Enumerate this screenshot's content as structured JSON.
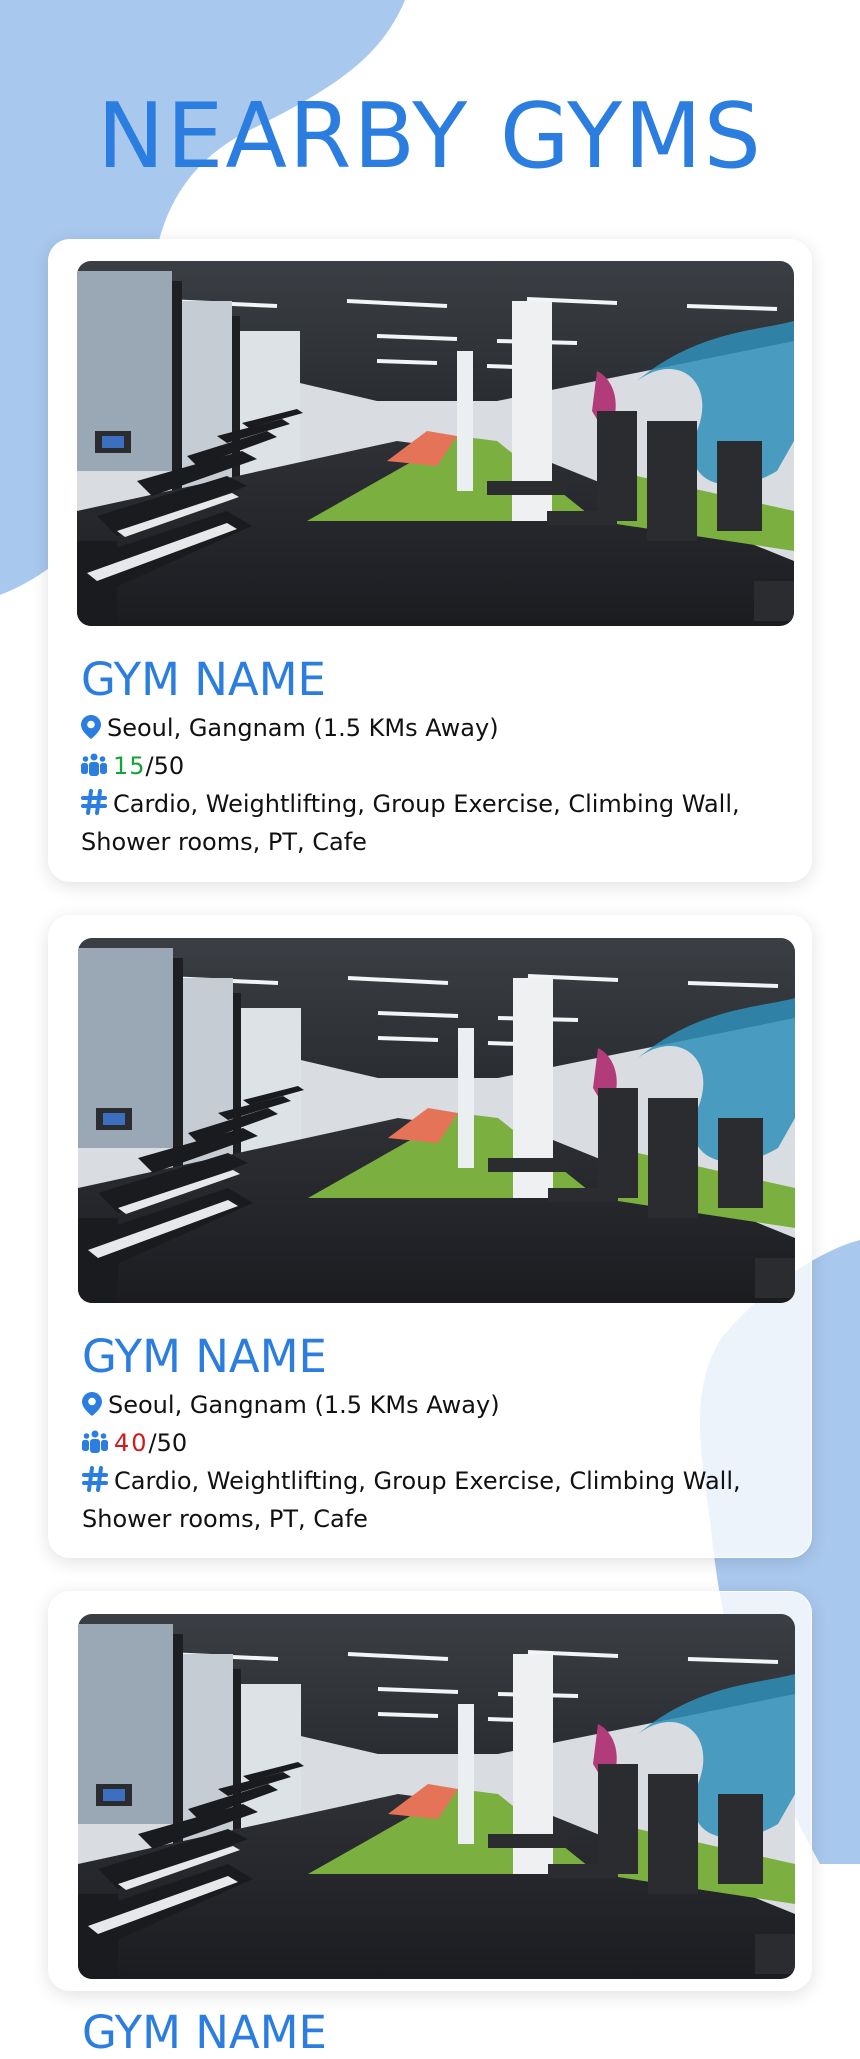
{
  "page": {
    "title": "NEARBY GYMS"
  },
  "colors": {
    "accent": "#2b7de0",
    "blob": "#a9c8ee",
    "available": "#18a33a",
    "busy": "#d11a1a"
  },
  "gyms": [
    {
      "name": "GYM NAME",
      "location": "Seoul, Gangnam (1.5 KMs Away)",
      "capacity_current": "15",
      "capacity_max": "/50",
      "capacity_status": "available",
      "facilities": "Cardio, Weightlifting, Group Exercise, Climbing Wall, Shower rooms, PT, Cafe"
    },
    {
      "name": "GYM NAME",
      "location": "Seoul, Gangnam (1.5 KMs Away)",
      "capacity_current": "40",
      "capacity_max": "/50",
      "capacity_status": "busy",
      "facilities": "Cardio, Weightlifting, Group Exercise, Climbing Wall, Shower rooms, PT, Cafe"
    },
    {
      "name": "GYM NAME"
    }
  ],
  "icons": {
    "location": "map-pin-icon",
    "capacity": "people-icon",
    "facilities": "hashtag-icon"
  }
}
